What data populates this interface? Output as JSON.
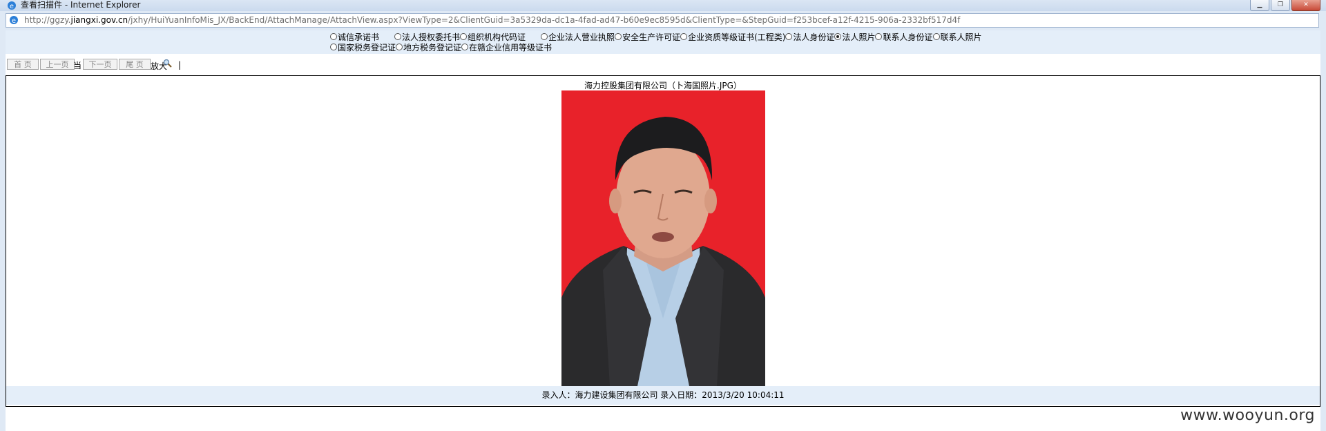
{
  "window": {
    "title": "查看扫描件 - Internet Explorer",
    "minimize_icon": "minimize-icon",
    "restore_icon": "restore-icon",
    "close_icon": "close-icon"
  },
  "address": {
    "url_prefix": "http://ggzy.",
    "url_domain": "jiangxi.gov.cn",
    "url_suffix": "/jxhy/HuiYuanInfoMis_JX/BackEnd/AttachManage/AttachView.aspx?ViewType=2&ClientGuid=3a5329da-dc1a-4fad-ad47-b60e9ec8595d&ClientType=&StepGuid=f253bcef-a12f-4215-906a-2332bf517d4f"
  },
  "radios": {
    "row1": [
      {
        "label": "诚信承诺书",
        "checked": false
      },
      {
        "label": "法人授权委托书",
        "checked": false
      },
      {
        "label": "组织机构代码证",
        "checked": false
      },
      {
        "label": "企业法人营业执照",
        "checked": false
      },
      {
        "label": "安全生产许可证",
        "checked": false
      },
      {
        "label": "企业资质等级证书(工程类)",
        "checked": false
      },
      {
        "label": "法人身份证",
        "checked": false
      },
      {
        "label": "法人照片",
        "checked": true
      },
      {
        "label": "联系人身份证",
        "checked": false
      },
      {
        "label": "联系人照片",
        "checked": false
      }
    ],
    "row2": [
      {
        "label": "国家税务登记证",
        "checked": false
      },
      {
        "label": "地方税务登记证",
        "checked": false
      },
      {
        "label": "在赣企业信用等级证书",
        "checked": false
      }
    ]
  },
  "pager": {
    "first": "首 页",
    "prev": "上一页",
    "next": "下一页",
    "last": "尾 页",
    "zoom_label": "放大",
    "partial_label": "当"
  },
  "viewer": {
    "caption": "海力控股集团有限公司（卜海国照片.JPG）",
    "footer": "录入人：海力建设集团有限公司 录入日期：2013/3/20 10:04:11"
  },
  "watermark": "www.wooyun.org",
  "colors": {
    "photo_background": "#e8222a",
    "selection_bar": "#e4eef9"
  }
}
